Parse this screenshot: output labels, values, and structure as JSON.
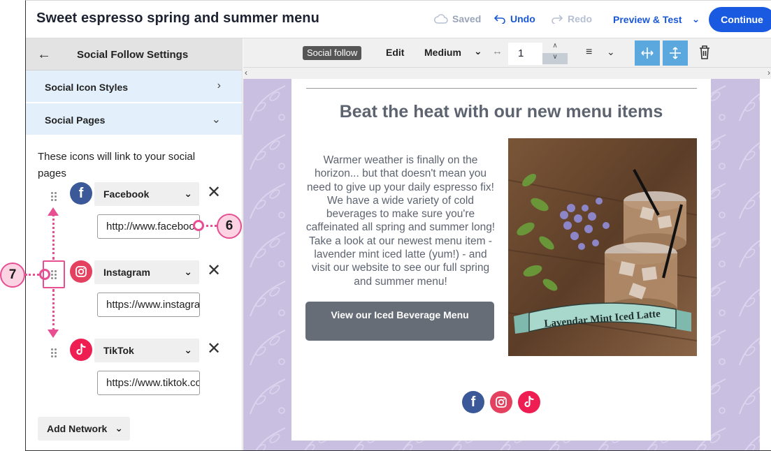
{
  "app": {
    "doc_title": "Sweet espresso spring and summer menu",
    "saved_label": "Saved",
    "undo_label": "Undo",
    "redo_label": "Redo",
    "preview_label": "Preview & Test",
    "continue_label": "Continue"
  },
  "panel": {
    "title": "Social Follow Settings",
    "sections": [
      {
        "label": "Social Icon Styles",
        "state": "collapsed"
      },
      {
        "label": "Social Pages",
        "state": "expanded"
      }
    ],
    "help_text": "These icons will link to your social pages",
    "networks": [
      {
        "name": "Facebook",
        "url": "http://www.facebook.com",
        "icon": "facebook-icon",
        "color": "#3b5998"
      },
      {
        "name": "Instagram",
        "url": "https://www.instagram.com",
        "icon": "instagram-icon",
        "color": "#e4405f"
      },
      {
        "name": "TikTok",
        "url": "https://www.tiktok.com",
        "icon": "tiktok-icon",
        "color": "#ee1d52"
      }
    ],
    "add_network_label": "Add Network"
  },
  "toolbar": {
    "block_label": "Social follow",
    "edit_label": "Edit",
    "size_label": "Medium",
    "spacing_value": "1"
  },
  "email": {
    "heading": "Beat the heat with our new menu items",
    "body": "Warmer weather is finally on the horizon... but that doesn't mean you need to give up your daily espresso fix! We have a wide variety of cold beverages to make sure you're caffeinated all spring and summer long! Take a look at our newest menu item - lavender mint iced latte (yum!) - and visit our website to see our full spring and summer menu!",
    "cta_label": "View our Iced Beverage Menu",
    "photo_banner": "Lavendar Mint Iced Latte"
  },
  "callouts": {
    "url_field": "6",
    "drag_handle": "7"
  },
  "colors": {
    "accent": "#1a5ae0",
    "callout": "#e84e92",
    "canvas_bg": "#c9bfe0",
    "toolbar_blue": "#5ba8df"
  }
}
